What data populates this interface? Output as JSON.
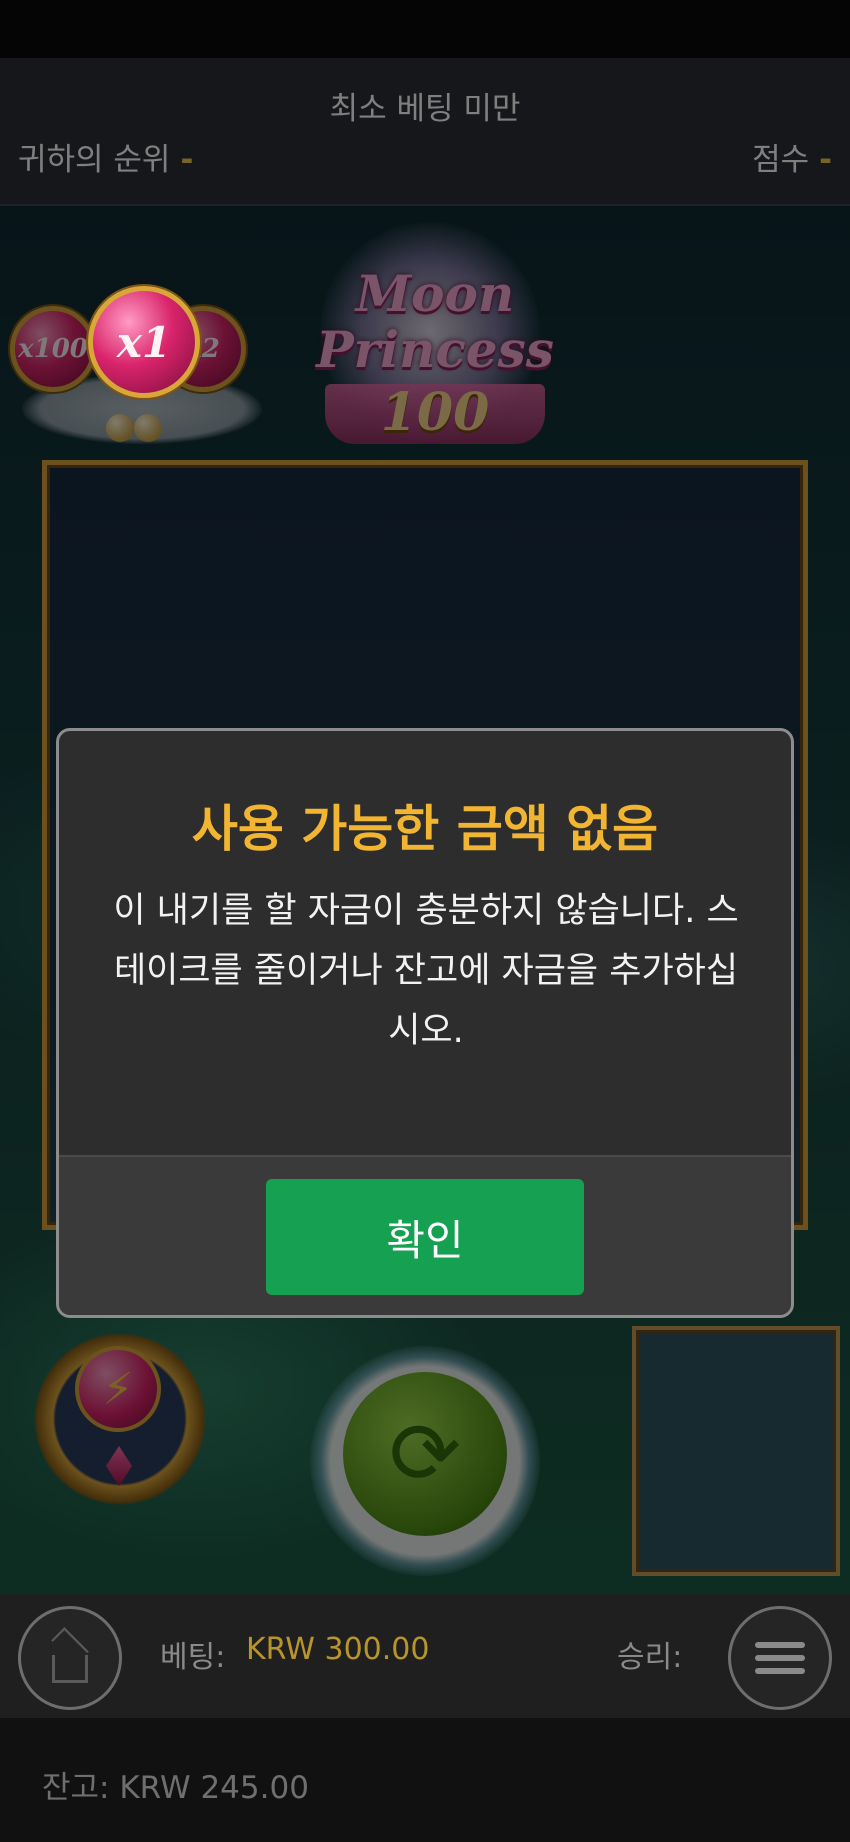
{
  "tournament": {
    "title": "최소 베팅 미만",
    "rank_label": "귀하의 순위",
    "rank_value": "-",
    "score_label": "점수",
    "score_value": "-"
  },
  "game": {
    "logo": {
      "line1": "Moon",
      "line2": "Princess",
      "line3": "100"
    },
    "multipliers": [
      "x100",
      "x1",
      "x2"
    ],
    "icons": {
      "power": "lightning-bolt-icon",
      "spin": "refresh-icon"
    }
  },
  "dialog": {
    "title": "사용 가능한 금액 없음",
    "message": "이 내기를 할 자금이 충분하지 않습니다. 스테이크를 줄이거나 잔고에 자금을 추가하십시오.",
    "confirm_label": "확인",
    "title_color": "#f2b531",
    "confirm_color": "#16a052"
  },
  "bottom": {
    "bet_label": "베팅:",
    "bet_value": "KRW 300.00",
    "win_label": "승리:",
    "balance_text": "잔고: KRW 245.00"
  }
}
